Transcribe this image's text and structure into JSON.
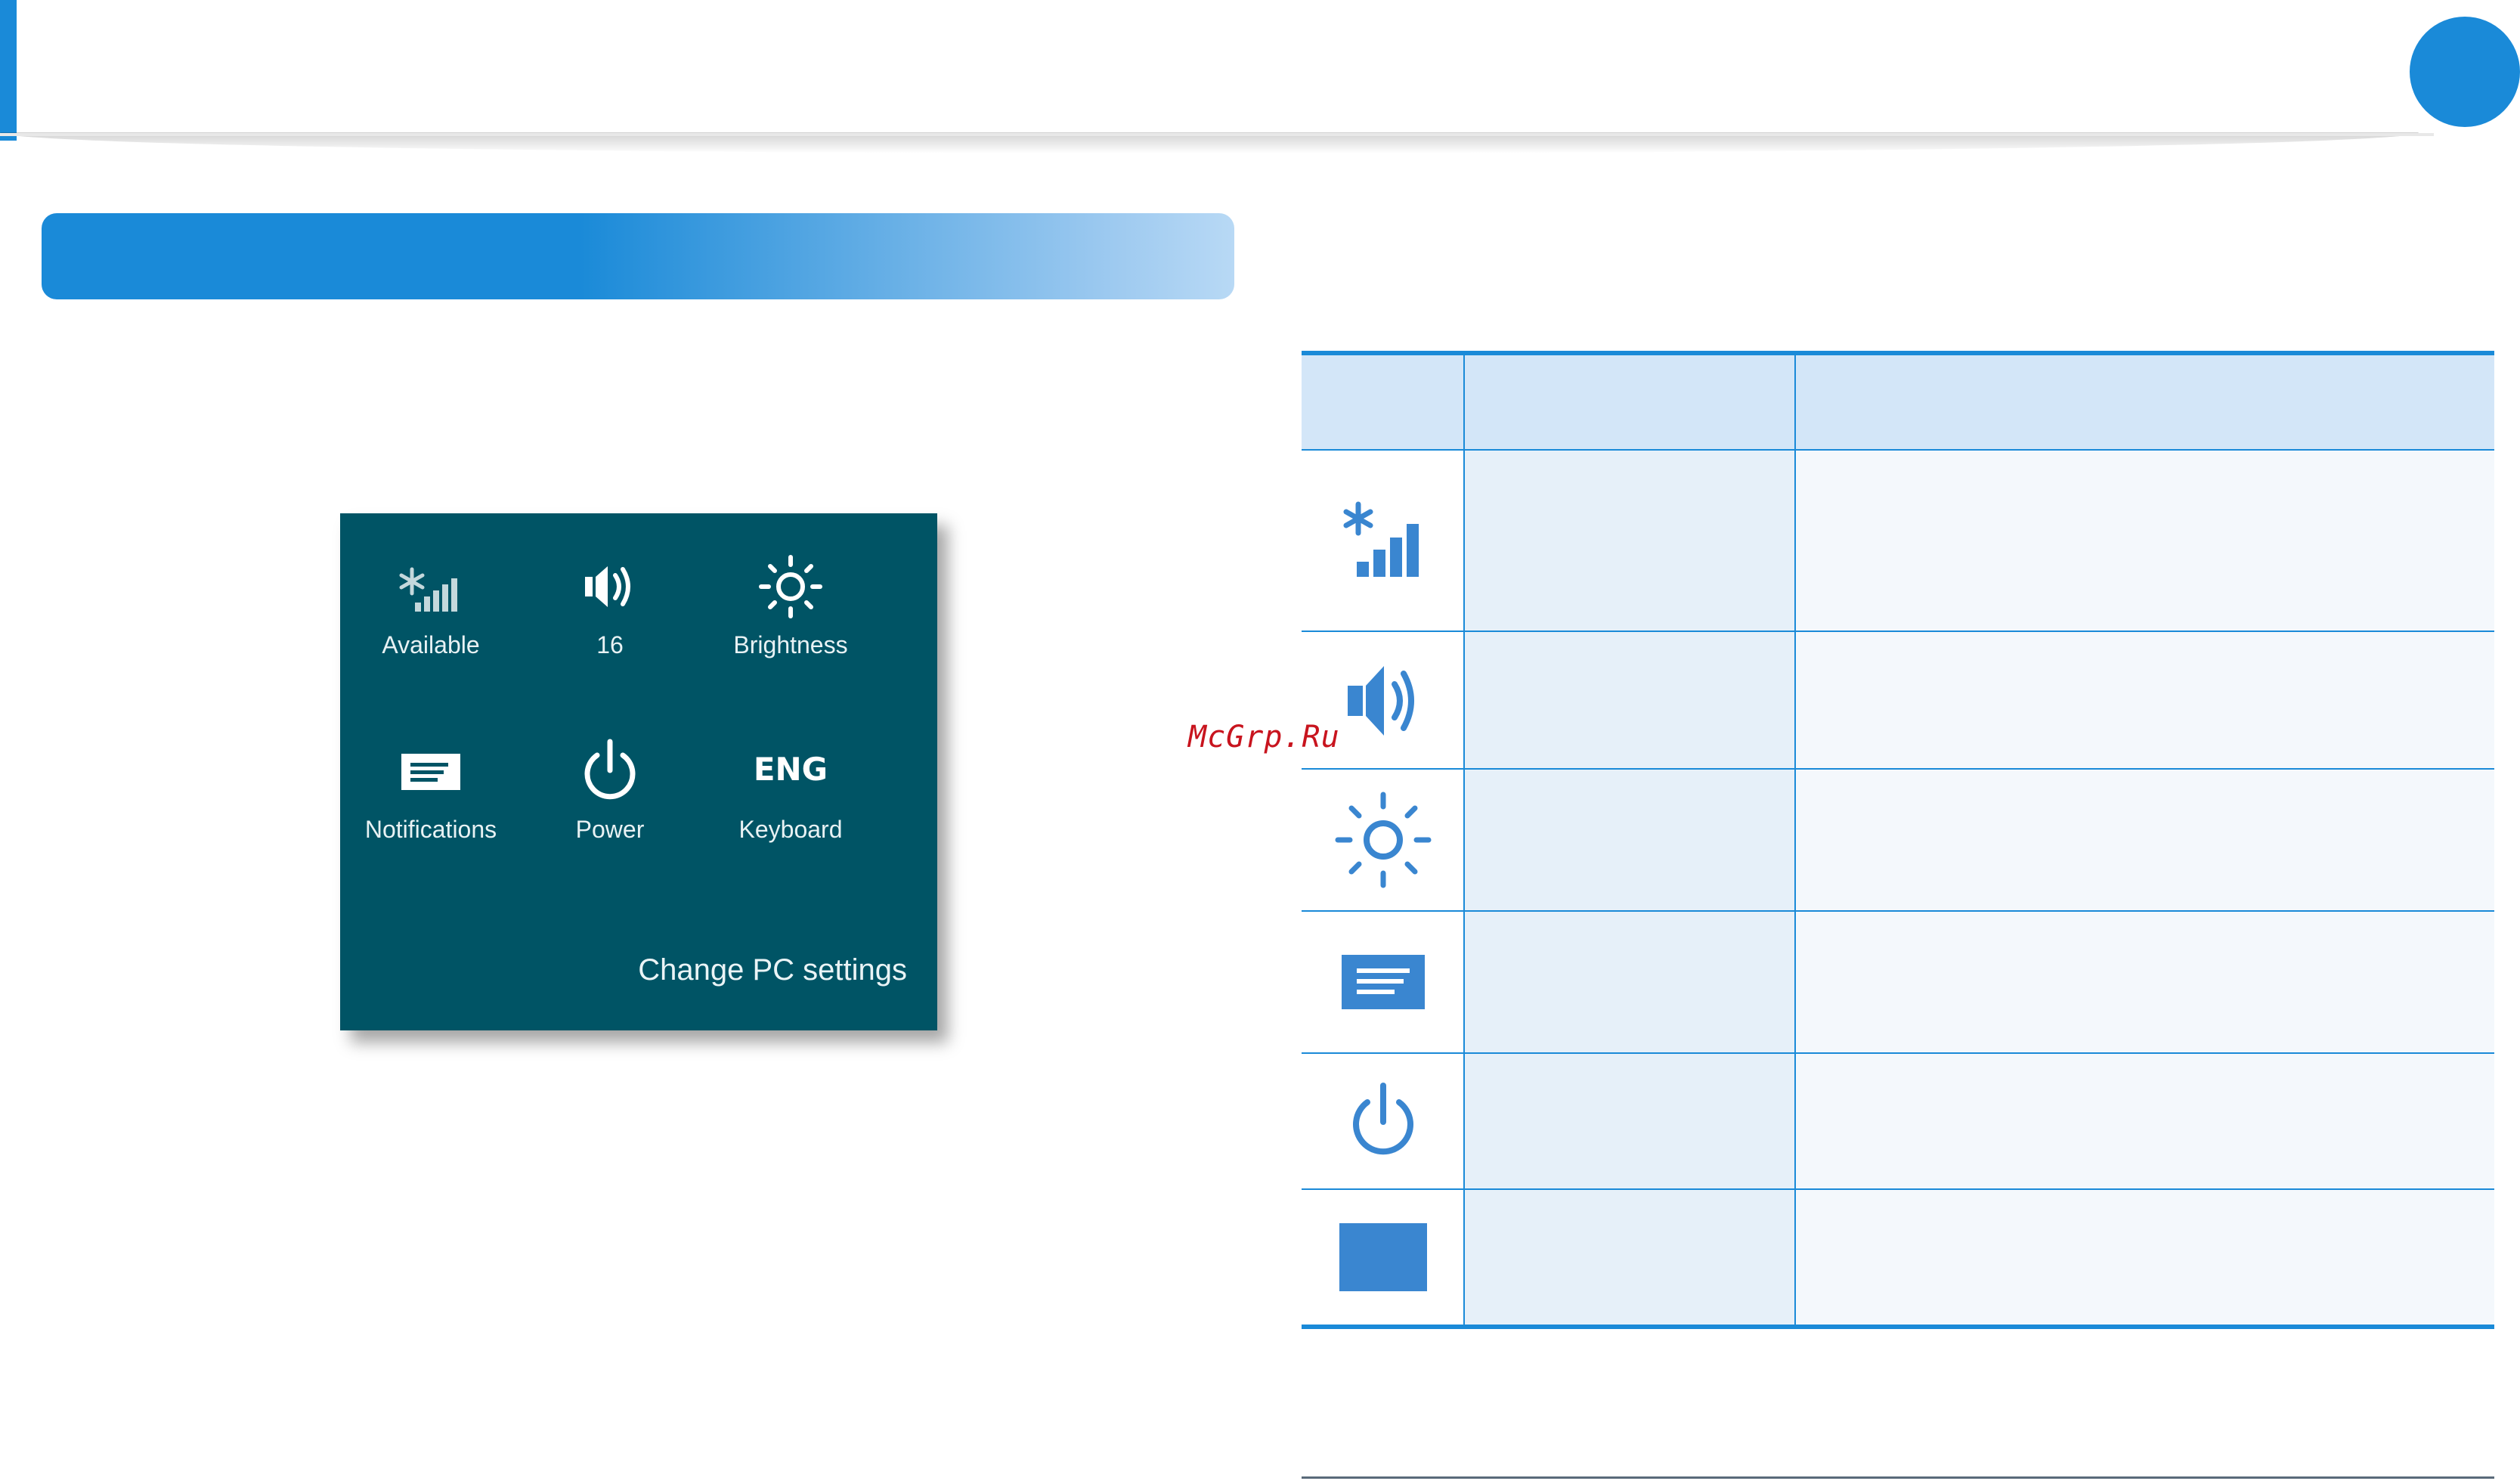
{
  "colors": {
    "accent_blue": "#1a8ad8",
    "panel_teal": "#005465",
    "table_header_fill": "#d3e6f8",
    "table_cell_fill": "#e6f0f9",
    "icon_blue": "#3a86d0",
    "watermark_red": "#c8141e"
  },
  "settings_panel": {
    "tiles": [
      {
        "label": "Available",
        "icon": "network-signal-icon"
      },
      {
        "label": "16",
        "icon": "speaker-icon"
      },
      {
        "label": "Brightness",
        "icon": "brightness-sun-icon"
      },
      {
        "label": "Notifications",
        "icon": "notifications-icon"
      },
      {
        "label": "Power",
        "icon": "power-icon"
      },
      {
        "label": "Keyboard",
        "icon": "keyboard-language-icon",
        "icon_text": "ENG"
      }
    ],
    "change_pc_settings": "Change PC settings"
  },
  "icon_table": {
    "rows": [
      {
        "icon": "network-signal-icon"
      },
      {
        "icon": "speaker-icon"
      },
      {
        "icon": "brightness-sun-icon"
      },
      {
        "icon": "notifications-icon"
      },
      {
        "icon": "power-icon"
      },
      {
        "icon": "keyboard-block-icon"
      }
    ]
  },
  "watermark": "McGrp.Ru"
}
